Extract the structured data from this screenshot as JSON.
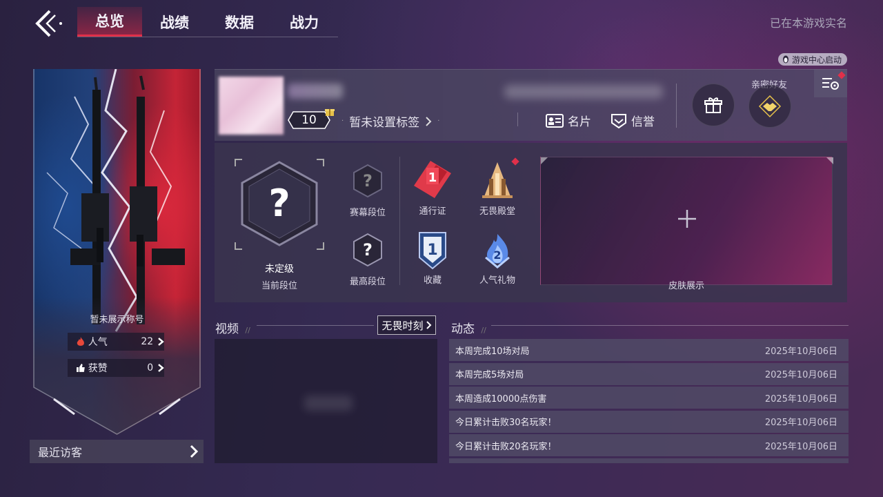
{
  "nav": {
    "tabs": [
      {
        "label": "总览",
        "active": true
      },
      {
        "label": "战绩",
        "active": false
      },
      {
        "label": "数据",
        "active": false
      },
      {
        "label": "战力",
        "active": false
      }
    ],
    "realname_status": "已在本游戏实名",
    "launch_badge": "游戏中心启动"
  },
  "banner": {
    "title": "暂未展示称号",
    "popularity": {
      "label": "人气",
      "value": "22"
    },
    "likes": {
      "label": "获赞",
      "value": "0"
    },
    "recent_visitors": "最近访客"
  },
  "profile": {
    "level": "10",
    "tag_prompt": "暂未设置标签",
    "card_label": "名片",
    "credit_label": "信誉",
    "close_friend_label": "亲密好友"
  },
  "ranks": {
    "current_rank_name": "未定级",
    "current_rank_label": "当前段位",
    "season_rank_label": "赛幕段位",
    "highest_rank_label": "最高段位",
    "pass_label": "通行证",
    "pass_level": "1",
    "hall_label": "无畏殿堂",
    "collection_label": "收藏",
    "collection_level": "1",
    "gift_label": "人气礼物",
    "gift_level": "2",
    "skin_label": "皮肤展示",
    "add_symbol": "+"
  },
  "video": {
    "title": "视频",
    "moments_button": "无畏时刻"
  },
  "feed": {
    "title": "动态",
    "items": [
      {
        "text": "本周完成10场对局",
        "date": "2025年10月06日"
      },
      {
        "text": "本周完成5场对局",
        "date": "2025年10月06日"
      },
      {
        "text": "本周造成10000点伤害",
        "date": "2025年10月06日"
      },
      {
        "text": "今日累计击败30名玩家！",
        "date": "2025年10月06日"
      },
      {
        "text": "今日累计击败20名玩家！",
        "date": "2025年10月06日"
      }
    ]
  },
  "colors": {
    "accent_red": "#e0304a",
    "gold": "#e8c24a",
    "blue_badge": "#4a78c8"
  }
}
